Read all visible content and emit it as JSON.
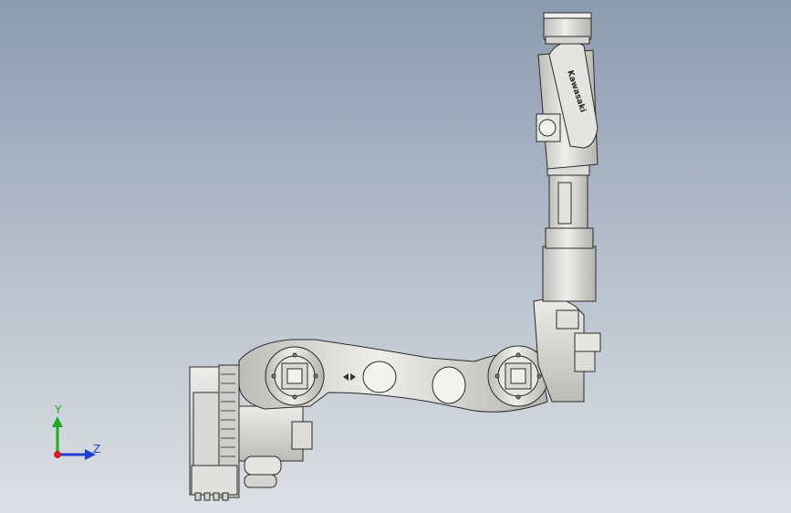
{
  "viewport": {
    "background_top": "#8c9bb0",
    "background_bottom": "#dde0e4"
  },
  "model": {
    "brand_text": "Kawasaki",
    "arm_fill": "#e8e8e6",
    "arm_shade": "#c9c9c5",
    "edge_color": "#2a2a2a"
  },
  "triad": {
    "y_label": "Y",
    "z_label": "Z",
    "y_color": "#22aa22",
    "z_color": "#1f3fd6",
    "x_color": "#d42020"
  }
}
